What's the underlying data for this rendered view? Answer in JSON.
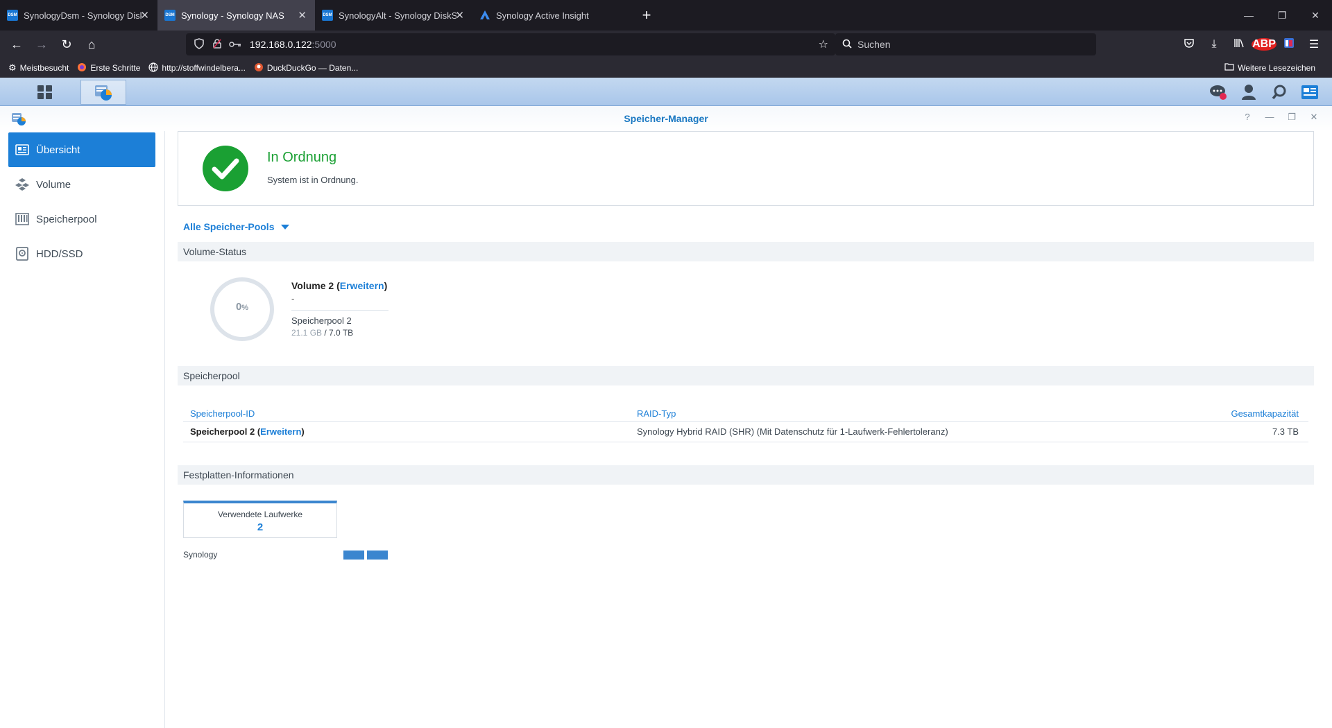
{
  "browser": {
    "tabs": [
      {
        "favicon": "DSM",
        "title": "SynologyDsm - Synology DiskStation",
        "active": false
      },
      {
        "favicon": "DSM",
        "title": "Synology - Synology NAS",
        "active": true
      },
      {
        "favicon": "DSM",
        "title": "SynologyAlt - Synology DiskStation",
        "active": false
      },
      {
        "favicon": "active-insight-icon",
        "title": "Synology Active Insight",
        "active": false
      }
    ],
    "url_host": "192.168.0.122",
    "url_port": ":5000",
    "search_placeholder": "Suchen",
    "abp_label": "ABP",
    "bookmarks": [
      {
        "icon": "gear-icon",
        "label": "Meistbesucht"
      },
      {
        "icon": "firefox-icon",
        "label": "Erste Schritte"
      },
      {
        "icon": "globe-icon",
        "label": "http://stoffwindelbera..."
      },
      {
        "icon": "duckduckgo-icon",
        "label": "DuckDuckGo — Daten..."
      }
    ],
    "other_bookmarks": "Weitere Lesezeichen"
  },
  "window": {
    "title": "Speicher-Manager"
  },
  "sidebar": {
    "items": [
      {
        "label": "Übersicht",
        "icon": "overview-icon",
        "active": true
      },
      {
        "label": "Volume",
        "icon": "volume-icon",
        "active": false
      },
      {
        "label": "Speicherpool",
        "icon": "storage-pool-icon",
        "active": false
      },
      {
        "label": "HDD/SSD",
        "icon": "hdd-icon",
        "active": false
      }
    ]
  },
  "status": {
    "title": "In Ordnung",
    "subtitle": "System ist in Ordnung."
  },
  "pool_filter": "Alle Speicher-Pools",
  "sections": {
    "volume_status": "Volume-Status",
    "storage_pool": "Speicherpool",
    "disk_info": "Festplatten-Informationen"
  },
  "volume": {
    "usage_value": "0",
    "usage_unit": "%",
    "name": "Volume 2",
    "link": "Erweitern",
    "description": "-",
    "pool": "Speicherpool 2",
    "used": "21.1 GB",
    "total": "7.0 TB"
  },
  "pool_table": {
    "headers": [
      "Speicherpool-ID",
      "RAID-Typ",
      "Gesamtkapazität"
    ],
    "rows": [
      {
        "id": "Speicherpool 2",
        "link": "Erweitern",
        "raid": "Synology Hybrid RAID (SHR) (Mit Datenschutz für 1-Laufwerk-Fehlertoleranz)",
        "capacity": "7.3 TB"
      }
    ]
  },
  "disks": {
    "label": "Verwendete Laufwerke",
    "count": "2",
    "enclosure": "Synology",
    "bay_color": "#3b86cf"
  },
  "colors": {
    "accent": "#1c7fd7",
    "ok_green": "#1aa033"
  }
}
